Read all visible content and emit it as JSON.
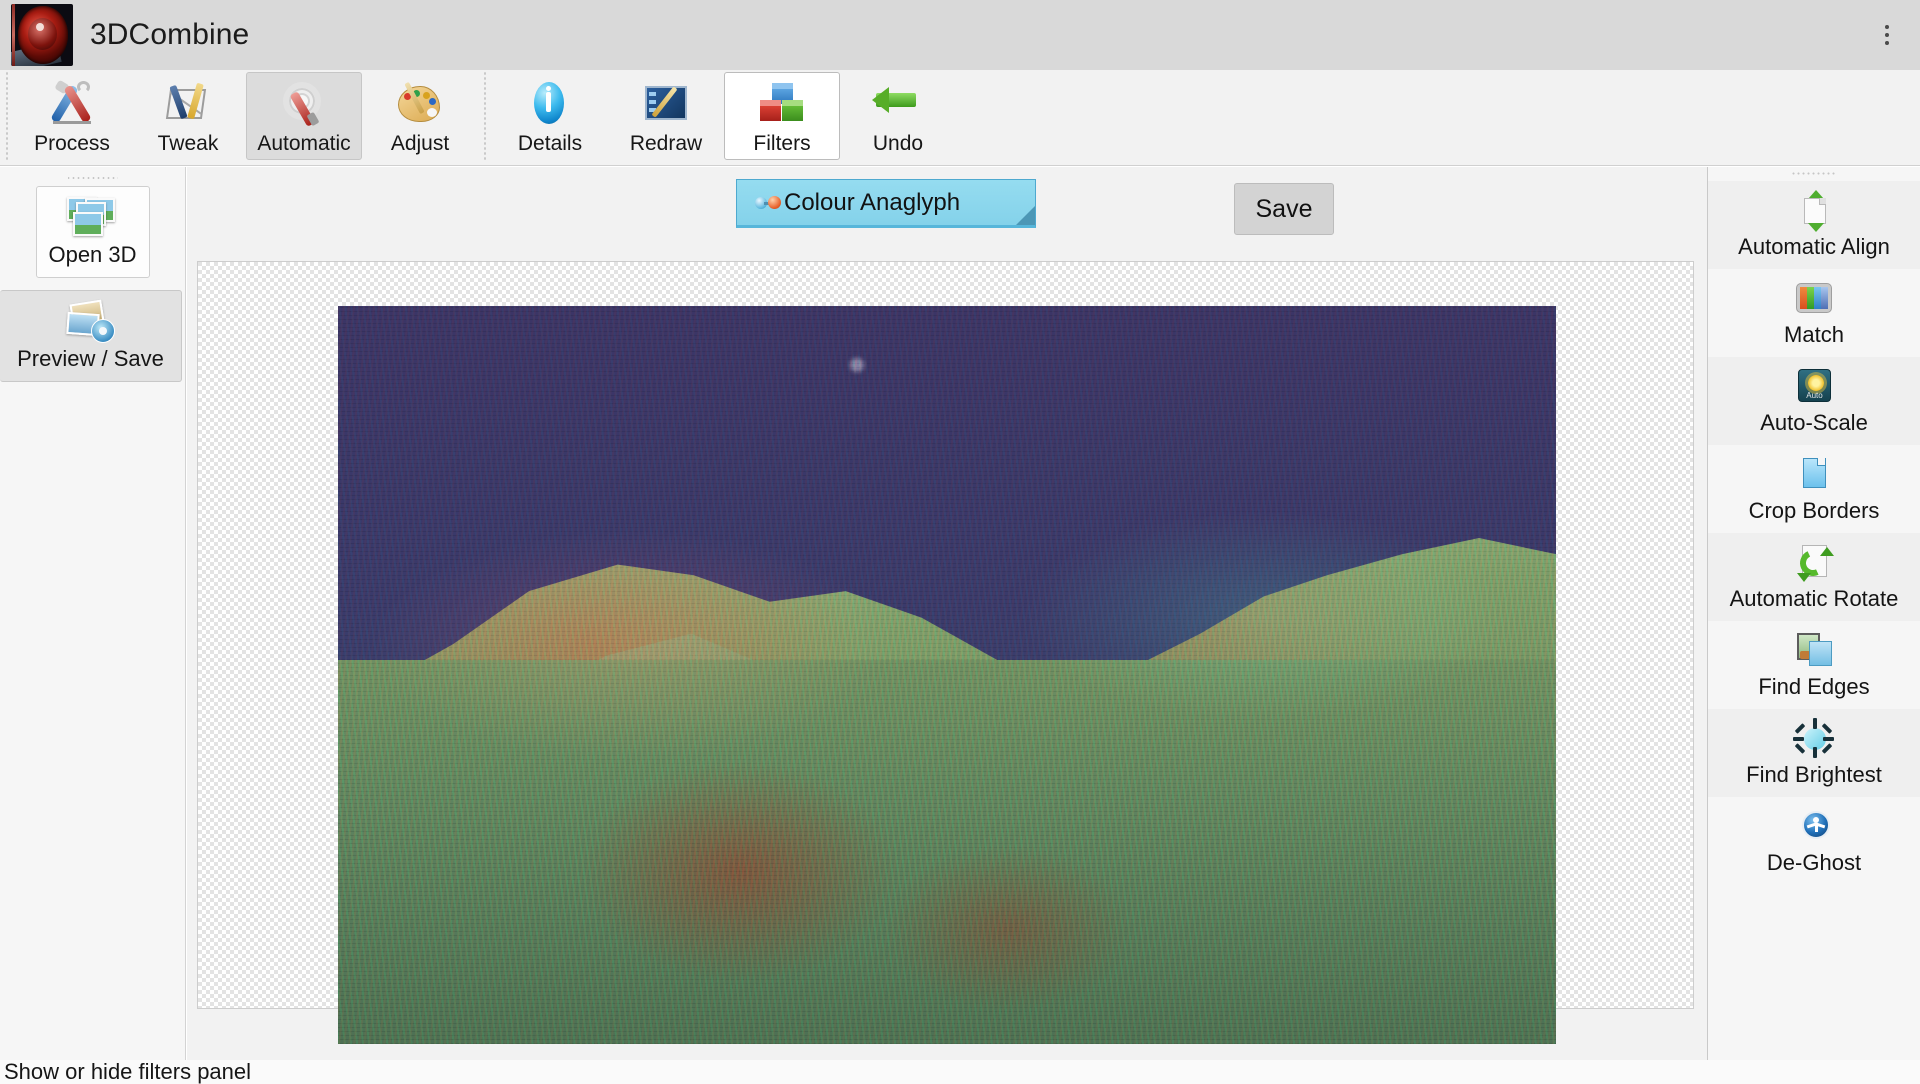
{
  "window": {
    "title": "3DCombine",
    "logo_icon": "camera-lens-icon",
    "overflow_icon": "kebab-menu-icon"
  },
  "toolbar": {
    "groups": [
      {
        "buttons": [
          {
            "label": "Process",
            "icon": "screwdriver-wrench-icon",
            "state": "normal"
          },
          {
            "label": "Tweak",
            "icon": "ruler-pencil-icon",
            "state": "normal"
          },
          {
            "label": "Automatic",
            "icon": "gear-screwdriver-icon",
            "state": "selected"
          },
          {
            "label": "Adjust",
            "icon": "paint-palette-icon",
            "state": "normal"
          }
        ]
      },
      {
        "buttons": [
          {
            "label": "Details",
            "icon": "info-icon",
            "state": "normal"
          },
          {
            "label": "Redraw",
            "icon": "screen-pencil-icon",
            "state": "normal"
          },
          {
            "label": "Filters",
            "icon": "color-cubes-icon",
            "state": "hovered"
          },
          {
            "label": "Undo",
            "icon": "undo-arrow-icon",
            "state": "normal"
          }
        ]
      }
    ]
  },
  "sidebar_left": {
    "items": [
      {
        "label": "Open 3D",
        "icon": "image-stack-icon",
        "state": "normal"
      },
      {
        "label": "Preview / Save",
        "icon": "photos-disc-icon",
        "state": "active"
      }
    ]
  },
  "main": {
    "mode_select": {
      "value": "Colour Anaglyph",
      "icon": "anaglyph-glasses-icon",
      "resize_icon": "resize-corner-icon"
    },
    "save_label": "Save",
    "canvas": {
      "name": "anaglyph-preview-canvas",
      "image_alt": "Red-cyan anaglyph photograph of a rocky desert mountain ridge under a deep blue twilight sky"
    }
  },
  "sidebar_right": {
    "items": [
      {
        "label": "Automatic Align",
        "icon": "align-document-arrows-icon",
        "state": "hovered"
      },
      {
        "label": "Match",
        "icon": "color-bars-screen-icon",
        "state": "normal"
      },
      {
        "label": "Auto-Scale",
        "icon": "auto-sun-icon",
        "state": "hovered"
      },
      {
        "label": "Crop Borders",
        "icon": "crop-page-icon",
        "state": "normal"
      },
      {
        "label": "Automatic Rotate",
        "icon": "rotate-arrows-icon",
        "state": "hovered"
      },
      {
        "label": "Find Edges",
        "icon": "two-photos-edges-icon",
        "state": "normal"
      },
      {
        "label": "Find Brightest",
        "icon": "sun-brightness-icon",
        "state": "hovered"
      },
      {
        "label": "De-Ghost",
        "icon": "person-circle-icon",
        "state": "normal"
      }
    ]
  },
  "statusbar": {
    "text": "Show or hide filters panel"
  },
  "colors": {
    "titlebar_bg": "#d9d9d9",
    "toolbar_bg": "#f2f2f2",
    "panel_bg": "#f6f6f6",
    "selected_bg": "#dcdcdc",
    "mode_select_bg": "#8ad6ec",
    "save_button_bg": "#d3d3d3"
  }
}
